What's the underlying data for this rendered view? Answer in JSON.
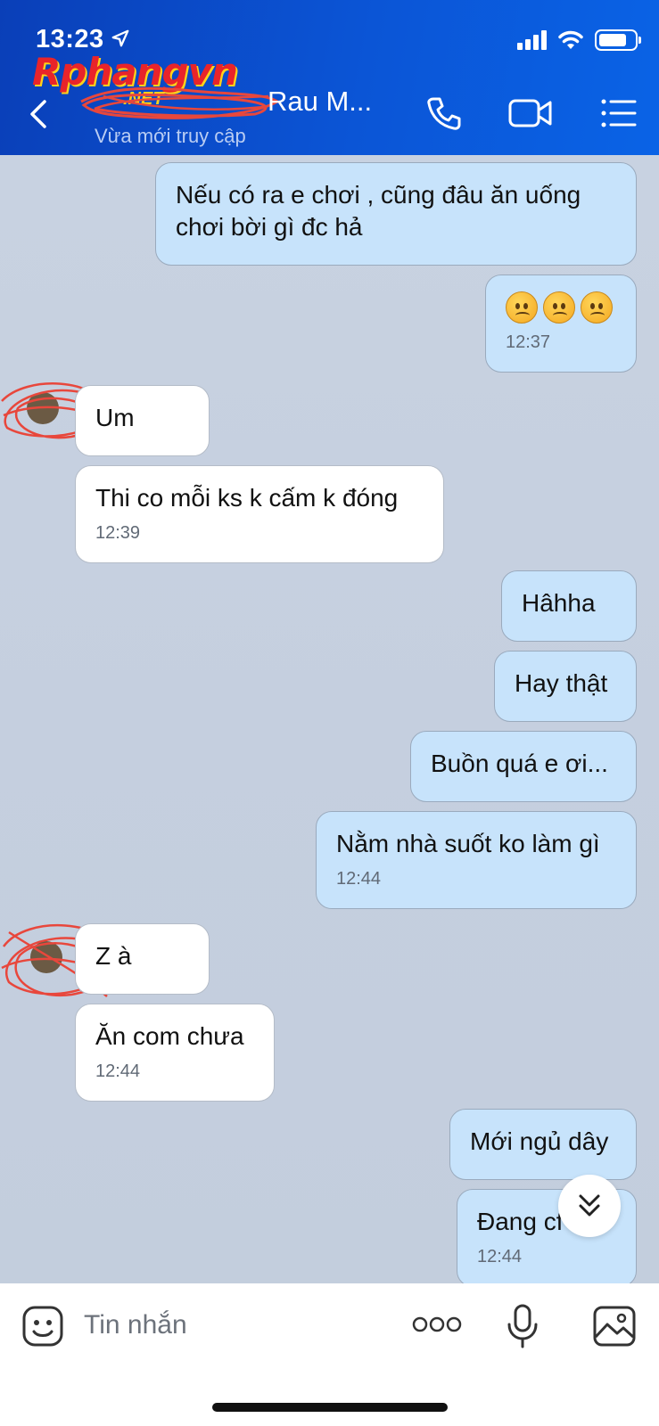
{
  "status_bar": {
    "time": "13:23"
  },
  "watermark": {
    "brand": "Rphangvn",
    "suffix": ".NET"
  },
  "header": {
    "contact_name": "Rau M...",
    "contact_status": "Vừa mới truy cập"
  },
  "messages": [
    {
      "side": "me",
      "text": "Nếu có ra e chơi , cũng đâu ăn uống chơi bời gì đc hả",
      "time": ""
    },
    {
      "side": "me",
      "text": "",
      "time": "12:37",
      "emoji": [
        "frowning",
        "frowning",
        "frowning"
      ]
    },
    {
      "side": "them",
      "text": "Um",
      "time": ""
    },
    {
      "side": "them",
      "text": "Thi co mỗi ks k cấm k đóng",
      "time": "12:39"
    },
    {
      "side": "me",
      "text": "Hâhha",
      "time": ""
    },
    {
      "side": "me",
      "text": "Hay thật",
      "time": ""
    },
    {
      "side": "me",
      "text": "Buồn quá e ơi...",
      "time": ""
    },
    {
      "side": "me",
      "text": "Nằm nhà suốt ko làm gì",
      "time": "12:44"
    },
    {
      "side": "them",
      "text": "Z à",
      "time": ""
    },
    {
      "side": "them",
      "text": "Ăn com chưa",
      "time": "12:44"
    },
    {
      "side": "me",
      "text": "Mới ngủ dây",
      "time": ""
    },
    {
      "side": "me",
      "text": "Đang cf em",
      "time": "12:44"
    }
  ],
  "input": {
    "placeholder": "Tin nhắn"
  },
  "colors": {
    "header": "#0b55d6",
    "my_bubble": "#c7e3fb",
    "their_bubble": "#ffffff",
    "chat_bg": "#c5cfdf"
  }
}
